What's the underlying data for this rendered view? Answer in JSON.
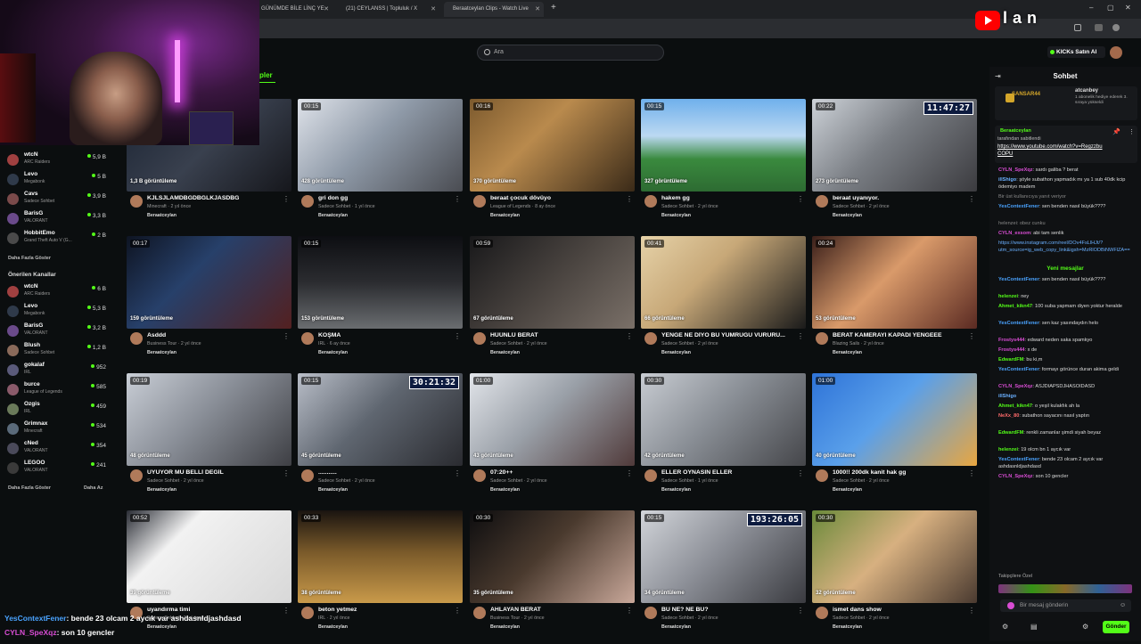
{
  "browser": {
    "tabs": [
      {
        "label": "GÜNÜMDE BİLE LİNÇ YE",
        "active": false
      },
      {
        "label": "(21) CEYLANSS | Topluluk / X",
        "active": false
      },
      {
        "label": "Beraatceylan Clips - Watch Live",
        "active": true
      }
    ],
    "new_tab": "+"
  },
  "overlay_logo": "lan",
  "header": {
    "search_placeholder": "Ara",
    "kick_button": "KICKs Satın Al",
    "section_tab": "pler"
  },
  "sidebar": {
    "followed": [
      {
        "name": "wtcN",
        "category": "ARC Raiders",
        "viewers": "5,9 B",
        "color": "#a04040"
      },
      {
        "name": "Levo",
        "category": "Megabonk",
        "viewers": "5 B",
        "color": "#2f3a4a"
      },
      {
        "name": "Cavs",
        "category": "Sadece Sohbet",
        "viewers": "3,9 B",
        "color": "#7a4a4a"
      },
      {
        "name": "BarisG",
        "category": "VALORANT",
        "viewers": "3,3 B",
        "color": "#6a4a8a"
      },
      {
        "name": "HobbitEmo",
        "category": "Grand Theft Auto V (G...",
        "viewers": "2 B",
        "color": "#4a4a4a"
      }
    ],
    "show_more": "Daha Fazla Göster",
    "recommended_heading": "Önerilen Kanallar",
    "recommended": [
      {
        "name": "wtcN",
        "category": "ARC Raiders",
        "viewers": "6 B",
        "color": "#a04040"
      },
      {
        "name": "Levo",
        "category": "Megabonk",
        "viewers": "5,3 B",
        "color": "#2f3a4a"
      },
      {
        "name": "BarisG",
        "category": "VALORANT",
        "viewers": "3,2 B",
        "color": "#6a4a8a"
      },
      {
        "name": "Blush",
        "category": "Sadece Sohbet",
        "viewers": "1,2 B",
        "color": "#8a6a5a"
      },
      {
        "name": "gokalaf",
        "category": "IRL",
        "viewers": "952",
        "color": "#5a5a7a"
      },
      {
        "name": "burce",
        "category": "League of Legends",
        "viewers": "585",
        "color": "#8a5a6a"
      },
      {
        "name": "Ozgis",
        "category": "IRL",
        "viewers": "459",
        "color": "#6a7a5a"
      },
      {
        "name": "Grimnax",
        "category": "Minecraft",
        "viewers": "534",
        "color": "#5a6a7a"
      },
      {
        "name": "cNed",
        "category": "VALORANT",
        "viewers": "354",
        "color": "#4a4a5a"
      },
      {
        "name": "LEGOO",
        "category": "VALORANT",
        "viewers": "241",
        "color": "#3a3a3a"
      }
    ],
    "show_more_2": "Daha Fazla Göster",
    "show_less": "Daha Az"
  },
  "clips": [
    {
      "duration": "",
      "views": "1,3 B görüntüleme",
      "title": "KJLSJLAMDBGDBGLKJASDBG",
      "meta": "Minecraft · 2 yıl önce",
      "channel": "Beraatceylan",
      "timer": "",
      "bg": "linear-gradient(135deg,#1b2433,#39404e 50%,#16171c)"
    },
    {
      "duration": "00:15",
      "views": "428 görüntüleme",
      "title": "gri don gg",
      "meta": "Sadece Sohbet · 1 yıl önce",
      "channel": "Beraatceylan",
      "timer": "",
      "bg": "linear-gradient(135deg,#dfe3ea,#8f9aa8 45%,#4a4c52)"
    },
    {
      "duration": "00:16",
      "views": "370 görüntüleme",
      "title": "beraat çocuk dövüyo",
      "meta": "League of Legends · 8 ay önce",
      "channel": "Beraatceylan",
      "timer": "",
      "bg": "linear-gradient(135deg,#7c5a2e,#b98a4d 40%,#3a2a18)"
    },
    {
      "duration": "00:15",
      "views": "327 görüntüleme",
      "title": "hakem gg",
      "meta": "Sadece Sohbet · 2 yıl önce",
      "channel": "Beraatceylan",
      "timer": "",
      "bg": "linear-gradient(180deg,#6fb0ec,#bcd9f2 40%,#3a8a3e 65%,#2d6b32)"
    },
    {
      "duration": "00:22",
      "views": "273 görüntüleme",
      "title": "beraat uyanıyor.",
      "meta": "Sadece Sohbet · 2 yıl önce",
      "channel": "Beraatceylan",
      "timer": "11:47:27",
      "bg": "linear-gradient(135deg,#cdd2d8,#7a7e84 45%,#3b3b3f)"
    },
    {
      "duration": "00:17",
      "views": "159 görüntüleme",
      "title": "Asddd",
      "meta": "Business Tour · 2 yıl önce",
      "channel": "Beraatceylan",
      "timer": "",
      "bg": "linear-gradient(135deg,#0e1422,#27406a 40%,#532020)"
    },
    {
      "duration": "00:15",
      "views": "153 görüntüleme",
      "title": "KOŞMA",
      "meta": "IRL · 6 ay önce",
      "channel": "Beraatceylan",
      "timer": "",
      "bg": "linear-gradient(180deg,#0d0e12,#2b2c30 50%,#6a6d70)"
    },
    {
      "duration": "00:59",
      "views": "67 görüntüleme",
      "title": "HÜÜNLÜ BERAT",
      "meta": "Sadece Sohbet · 2 yıl önce",
      "channel": "Beraatceylan",
      "timer": "",
      "bg": "linear-gradient(135deg,#18181a,#4a4440 50%,#7a7068)"
    },
    {
      "duration": "00:41",
      "views": "66 görüntüleme",
      "title": "YENGE NE DİYO BU YUMRUĞU VURURU...",
      "meta": "Sadece Sohbet · 2 yıl önce",
      "channel": "Beraatceylan",
      "timer": "",
      "bg": "linear-gradient(135deg,#e6d2a8,#c7a878 40%,#1a1a1a)"
    },
    {
      "duration": "00:24",
      "views": "53 görüntüleme",
      "title": "BERAT KAMERAYI KAPADI YENGEEE",
      "meta": "Blazing Sails · 2 yıl önce",
      "channel": "Beraatceylan",
      "timer": "",
      "bg": "linear-gradient(135deg,#3a1f1a,#d99a6a 45%,#5a2a22)"
    },
    {
      "duration": "00:19",
      "views": "48 görüntüleme",
      "title": "UYUYOR MU BELLİ DEĞİL",
      "meta": "Sadece Sohbet · 2 yıl önce",
      "channel": "Beraatceylan",
      "timer": "",
      "bg": "linear-gradient(135deg,#c9ced6,#8a8f98 45%,#3e3f44)"
    },
    {
      "duration": "00:15",
      "views": "45 görüntüleme",
      "title": "...........",
      "meta": "Sadece Sohbet · 2 yıl önce",
      "channel": "Beraatceylan",
      "timer": "30:21:32",
      "bg": "linear-gradient(135deg,#b9bec8,#5f6670 45%,#2a2b30)"
    },
    {
      "duration": "01:00",
      "views": "43 görüntüleme",
      "title": "07:20++",
      "meta": "Sadece Sohbet · 2 yıl önce",
      "channel": "Beraatceylan",
      "timer": "",
      "bg": "linear-gradient(135deg,#e2e5ea,#9aa0a8 45%,#503a3a)"
    },
    {
      "duration": "00:30",
      "views": "42 görüntüleme",
      "title": "ELLER OYNASIN ELLER",
      "meta": "Sadece Sohbet · 1 yıl önce",
      "channel": "Beraatceylan",
      "timer": "",
      "bg": "linear-gradient(135deg,#c8ccd2,#8a8f96 45%,#45464a)"
    },
    {
      "duration": "01:00",
      "views": "40 görüntüleme",
      "title": "1000!! 200dk kanit hak gg",
      "meta": "Sadece Sohbet · 2 yıl önce",
      "channel": "Beraatceylan",
      "timer": "",
      "bg": "linear-gradient(135deg,#2e73d8,#5aa0ea 45%,#e8a640)"
    },
    {
      "duration": "00:52",
      "views": "39 görüntüleme",
      "title": "uyandırma timi",
      "meta": "Sadece Sohbet · 2 yıl önce",
      "channel": "Beraatceylan",
      "timer": "",
      "bg": "linear-gradient(135deg,#2a2d35,#f2f2f2 30%,#d8d8d8)"
    },
    {
      "duration": "00:33",
      "views": "38 görüntüleme",
      "title": "beton yetmez",
      "meta": "IRL · 2 yıl önce",
      "channel": "Beraatceylan",
      "timer": "",
      "bg": "linear-gradient(180deg,#1a1410,#7a5a2a 45%,#c99a4a)"
    },
    {
      "duration": "00:30",
      "views": "35 görüntüleme",
      "title": "AHLAYAN BERAT",
      "meta": "Business Tour · 2 yıl önce",
      "channel": "Beraatceylan",
      "timer": "",
      "bg": "linear-gradient(135deg,#0d0d0f,#4a3a2e 45%,#c9a89a)"
    },
    {
      "duration": "00:15",
      "views": "34 görüntüleme",
      "title": "BU NE? NE BU?",
      "meta": "Sadece Sohbet · 2 yıl önce",
      "channel": "Beraatceylan",
      "timer": "193:26:05",
      "bg": "linear-gradient(135deg,#d2d5da,#8d9098 45%,#3a3b40)"
    },
    {
      "duration": "00:30",
      "views": "32 görüntüleme",
      "title": "ismet dans show",
      "meta": "Sadece Sohbet · 2 yıl önce",
      "channel": "Beraatceylan",
      "timer": "",
      "bg": "linear-gradient(135deg,#6a8a3a,#d7b080 45%,#4a3a30)"
    }
  ],
  "chat": {
    "title": "Sohbet",
    "gift": {
      "user": "SANSAR44",
      "gifter": "atcanbey",
      "text": "1 abonelik hediye ederek 3. sıraya yükseldi"
    },
    "pinned": {
      "user": "Beraatceylan",
      "line1": "tarafından sabitlendi",
      "link": "https://www.youtube.com/watch?v=RegzzbuCOPU"
    },
    "messages_top": [
      {
        "user": "CYLN_SpeXqz",
        "color": "#d94dd4",
        "text": "sardı galiba ? berat"
      },
      {
        "user": "illShigo",
        "color": "#6ab0ff",
        "text": "şöyle subathon yapmadık mı ya 1 sub 40dk kcip ödemiyo madem"
      },
      {
        "user": "",
        "color": "#888",
        "text": "Bir üst kullanıcıya yanıt veriyor"
      },
      {
        "user": "YesContextFener",
        "color": "#4aa3ff",
        "text": "sen benden nasıl büyük????"
      },
      {
        "user": "",
        "color": "#888",
        "text": "helenzei: obez cunku"
      },
      {
        "user": "CYLN_exsom",
        "color": "#d94dd4",
        "text": "abi tam senlik"
      },
      {
        "user": "",
        "color": "#6ab0ff",
        "text": "https://www.instagram.com/reel/DOv4FsLlHJt/?utm_source=ig_web_copy_link&igsh=MzRlODBiNWFlZA=="
      }
    ],
    "new_messages": "Yeni mesajlar",
    "messages_bottom": [
      {
        "user": "YesContextFener",
        "color": "#4aa3ff",
        "text": "sen benden nasıl büyük????"
      },
      {
        "user": "helenzei",
        "color": "#53fc18",
        "text": "ney"
      },
      {
        "user": "Ahmet_kikn47",
        "color": "#53fc18",
        "text": "100 suba yapmam diyen yoktur heralde"
      },
      {
        "user": "YesContextFener",
        "color": "#4aa3ff",
        "text": "sen kaz yasındaydın helo"
      },
      {
        "user": "Frostys444",
        "color": "#d94dd4",
        "text": "edward neden saka spamkyo"
      },
      {
        "user": "Frostys444",
        "color": "#d94dd4",
        "text": "x de"
      },
      {
        "user": "EdwardFM",
        "color": "#53fc18",
        "text": "bu ki,m"
      },
      {
        "user": "YesContextFener",
        "color": "#4aa3ff",
        "text": "formayı görünce duran akima geldi"
      },
      {
        "user": "CYLN_SpeXqz",
        "color": "#d94dd4",
        "text": "ASJDIAPSDJHASOIDASD"
      },
      {
        "user": "illShigo",
        "color": "#6ab0ff",
        "text": ""
      },
      {
        "user": "Ahmet_kikn47",
        "color": "#53fc18",
        "text": "o yeşil kulakfık ah la"
      },
      {
        "user": "NeXx_80",
        "color": "#ff6a6a",
        "text": "subathon sayacını nasıl yaptın"
      },
      {
        "user": "EdwardFM",
        "color": "#53fc18",
        "text": "renkli zamanlar şimdi siyah beyaz"
      },
      {
        "user": "helenzei",
        "color": "#53fc18",
        "text": "19 olcm bn 1 aycık var"
      },
      {
        "user": "YesContextFener",
        "color": "#4aa3ff",
        "text": "bende 23 olcam 2 aycık var ashdasnldjashdasd"
      },
      {
        "user": "CYLN_SpeXqz",
        "color": "#d94dd4",
        "text": "son 10 gencler"
      }
    ],
    "emote_row_label": "Takipçilere Özel",
    "input_placeholder": "Bir mesaj gönderin",
    "send_button": "Gönder"
  },
  "stream_overlay": [
    {
      "user": "YesContextFener",
      "color": "#4aa3ff",
      "text": ": bende 23 olcam 2 aycık var ashdasnldjashdasd"
    },
    {
      "user": "CYLN_SpeXqz",
      "color": "#d94dd4",
      "text": ": son 10 gencler"
    }
  ]
}
